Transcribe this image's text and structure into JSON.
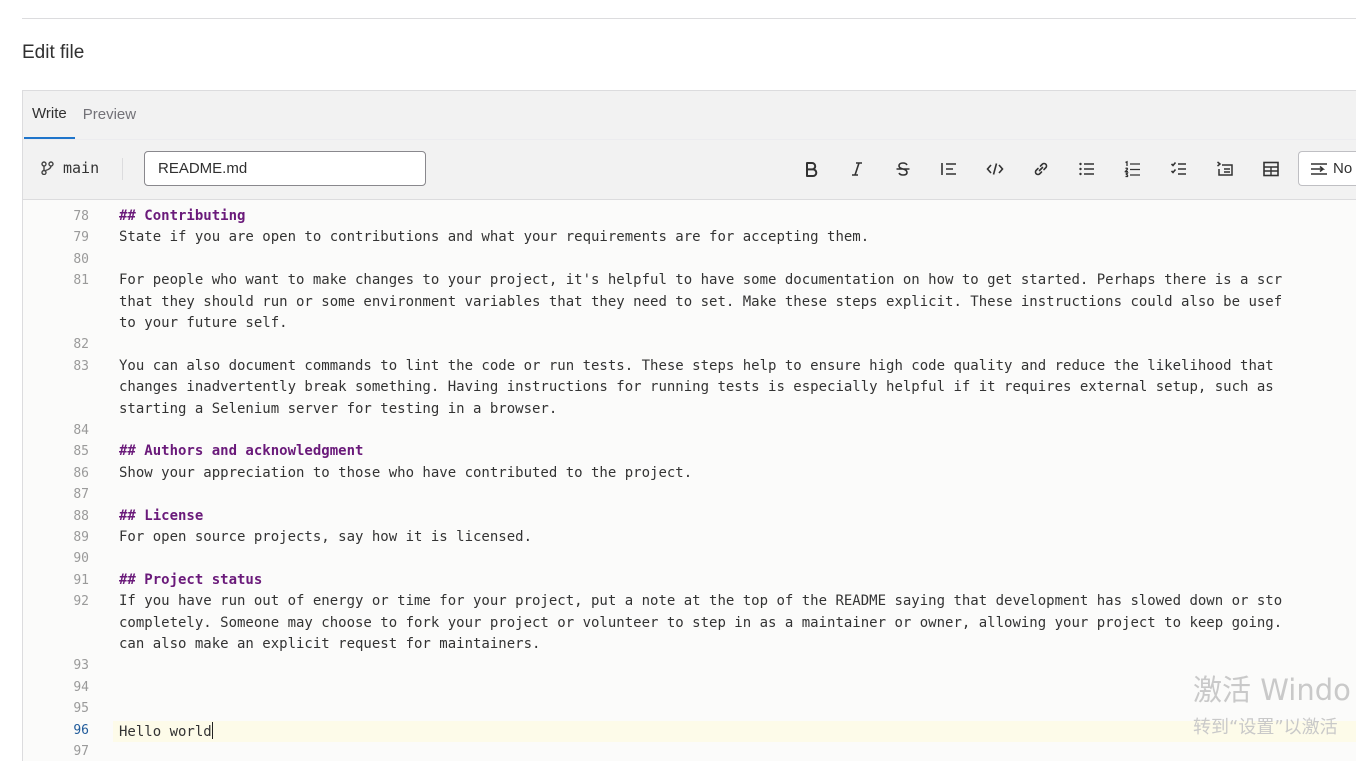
{
  "page": {
    "title": "Edit file"
  },
  "tabs": [
    {
      "label": "Write",
      "active": true
    },
    {
      "label": "Preview",
      "active": false
    }
  ],
  "toolbar": {
    "branch": "main",
    "filename": "README.md",
    "buttons": [
      {
        "name": "bold-icon",
        "label": "Bold"
      },
      {
        "name": "italic-icon",
        "label": "Italic"
      },
      {
        "name": "strikethrough-icon",
        "label": "Strikethrough"
      },
      {
        "name": "quote-icon",
        "label": "Quote"
      },
      {
        "name": "code-icon",
        "label": "Code"
      },
      {
        "name": "link-icon",
        "label": "Link"
      },
      {
        "name": "bulleted-list-icon",
        "label": "Bulleted list"
      },
      {
        "name": "numbered-list-icon",
        "label": "Numbered list"
      },
      {
        "name": "task-list-icon",
        "label": "Task list"
      },
      {
        "name": "collapsible-section-icon",
        "label": "Collapsible section"
      },
      {
        "name": "table-icon",
        "label": "Table"
      }
    ],
    "wrap_label": "No"
  },
  "editor": {
    "lines": [
      {
        "num": "78",
        "text": "## Contributing",
        "heading": true
      },
      {
        "num": "79",
        "text": "State if you are open to contributions and what your requirements are for accepting them."
      },
      {
        "num": "80",
        "text": ""
      },
      {
        "num": "81",
        "text": "For people who want to make changes to your project, it's helpful to have some documentation on how to get started. Perhaps there is a scr"
      },
      {
        "num": "",
        "text": "that they should run or some environment variables that they need to set. Make these steps explicit. These instructions could also be usef"
      },
      {
        "num": "",
        "text": "to your future self."
      },
      {
        "num": "82",
        "text": ""
      },
      {
        "num": "83",
        "text": "You can also document commands to lint the code or run tests. These steps help to ensure high code quality and reduce the likelihood that"
      },
      {
        "num": "",
        "text": "changes inadvertently break something. Having instructions for running tests is especially helpful if it requires external setup, such as"
      },
      {
        "num": "",
        "text": "starting a Selenium server for testing in a browser."
      },
      {
        "num": "84",
        "text": ""
      },
      {
        "num": "85",
        "text": "## Authors and acknowledgment",
        "heading": true
      },
      {
        "num": "86",
        "text": "Show your appreciation to those who have contributed to the project."
      },
      {
        "num": "87",
        "text": ""
      },
      {
        "num": "88",
        "text": "## License",
        "heading": true
      },
      {
        "num": "89",
        "text": "For open source projects, say how it is licensed."
      },
      {
        "num": "90",
        "text": ""
      },
      {
        "num": "91",
        "text": "## Project status",
        "heading": true
      },
      {
        "num": "92",
        "text": "If you have run out of energy or time for your project, put a note at the top of the README saying that development has slowed down or sto"
      },
      {
        "num": "",
        "text": "completely. Someone may choose to fork your project or volunteer to step in as a maintainer or owner, allowing your project to keep going."
      },
      {
        "num": "",
        "text": "can also make an explicit request for maintainers."
      },
      {
        "num": "93",
        "text": ""
      },
      {
        "num": "94",
        "text": ""
      },
      {
        "num": "95",
        "text": ""
      },
      {
        "num": "96",
        "text": "Hello world",
        "current": true
      },
      {
        "num": "97",
        "text": ""
      }
    ]
  },
  "watermark": {
    "line1": "激活 Windo",
    "line2": "转到“设置”以激活"
  },
  "colors": {
    "accent": "#1f75cb",
    "heading": "#6a1a7a"
  }
}
